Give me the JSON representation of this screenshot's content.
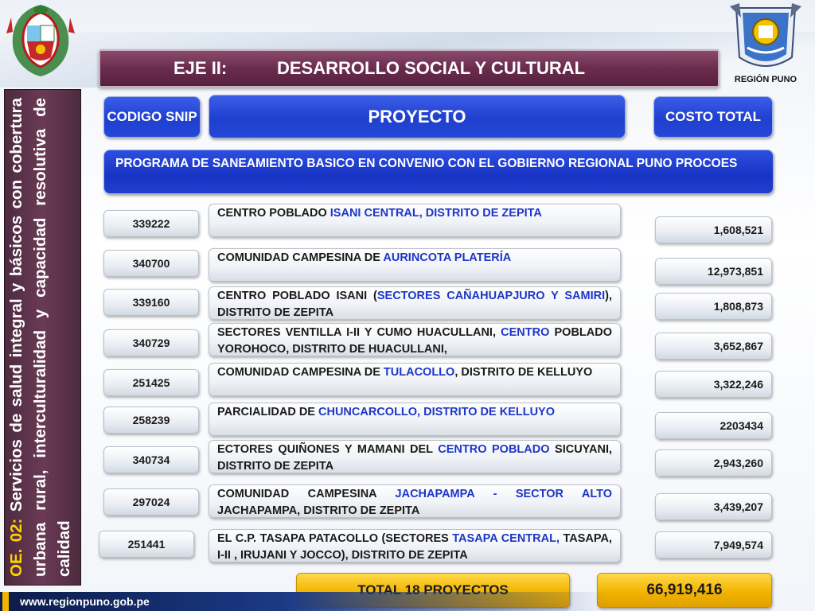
{
  "header": {
    "eje": "EJE II:",
    "title": "DESARROLLO SOCIAL Y CULTURAL",
    "right_logo_caption": "REGIÓN PUNO"
  },
  "side": {
    "oe": "OE. 02:",
    "text": "Servicios de salud integral y básicos con cobertura urbana rural, interculturalidad y capacidad resolutiva de calidad"
  },
  "columns": {
    "codigo": "CODIGO SNIP",
    "proyecto": "PROYECTO",
    "costo": "COSTO TOTAL"
  },
  "program": "PROGRAMA DE SANEAMIENTO BASICO  EN CONVENIO CON EL GOBIERNO REGIONAL PUNO PROCOES",
  "rows": [
    {
      "code": "339222",
      "desc_a": "CENTRO POBLADO ",
      "desc_hl": "ISANI CENTRAL, DISTRITO DE ZEPITA",
      "desc_b": "",
      "cost": "1,608,521"
    },
    {
      "code": "340700",
      "desc_a": "COMUNIDAD CAMPESINA DE ",
      "desc_hl": "AURINCOTA PLATERÍA",
      "desc_b": "",
      "cost": "12,973,851"
    },
    {
      "code": "339160",
      "desc_a": " CENTRO POBLADO ISANI (",
      "desc_hl": "SECTORES CAÑAHUAPJURO Y SAMIRI",
      "desc_b": "), DISTRITO DE ZEPITA",
      "cost": "1,808,873"
    },
    {
      "code": "340729",
      "desc_a": "SECTORES VENTILLA I-II Y CUMO HUACULLANI, ",
      "desc_hl": "CENTRO",
      "desc_b": " POBLADO YOROHOCO, DISTRITO DE HUACULLANI,",
      "cost": "3,652,867"
    },
    {
      "code": "251425",
      "desc_a": "COMUNIDAD CAMPESINA DE ",
      "desc_hl": "TULACOLLO",
      "desc_b": ", DISTRITO DE KELLUYO",
      "cost": "3,322,246"
    },
    {
      "code": "258239",
      "desc_a": "PARCIALIDAD DE ",
      "desc_hl": "CHUNCARCOLLO, DISTRITO DE KELLUYO",
      "desc_b": "",
      "cost": "2203434"
    },
    {
      "code": "340734",
      "desc_a": "ECTORES QUIÑONES Y MAMANI DEL ",
      "desc_hl": "CENTRO POBLADO",
      "desc_b": " SICUYANI, DISTRITO DE ZEPITA",
      "cost": "2,943,260"
    },
    {
      "code": "297024",
      "desc_a": "COMUNIDAD CAMPESINA ",
      "desc_hl": "JACHAPAMPA - SECTOR ALTO",
      "desc_b": " JACHAPAMPA, DISTRITO DE ZEPITA",
      "cost": "3,439,207"
    },
    {
      "code": "251441",
      "desc_a": "EL C.P. TASAPA PATACOLLO (SECTORES ",
      "desc_hl": "TASAPA CENTRAL,",
      "desc_b": " TASAPA, I-II , IRUJANI Y JOCCO), DISTRITO DE ZEPITA",
      "cost": "7,949,574"
    }
  ],
  "total": {
    "label": "TOTAL 18 PROYECTOS",
    "value": "66,919,416"
  },
  "footer": {
    "url": "www.regionpuno.gob.pe"
  },
  "colors": {
    "title_bar": "#6a2c4d",
    "header_blue": "#1f3fcf",
    "highlight_text": "#1c36c8",
    "total_gold": "#f2b400",
    "oe_yellow": "#ffd400"
  }
}
